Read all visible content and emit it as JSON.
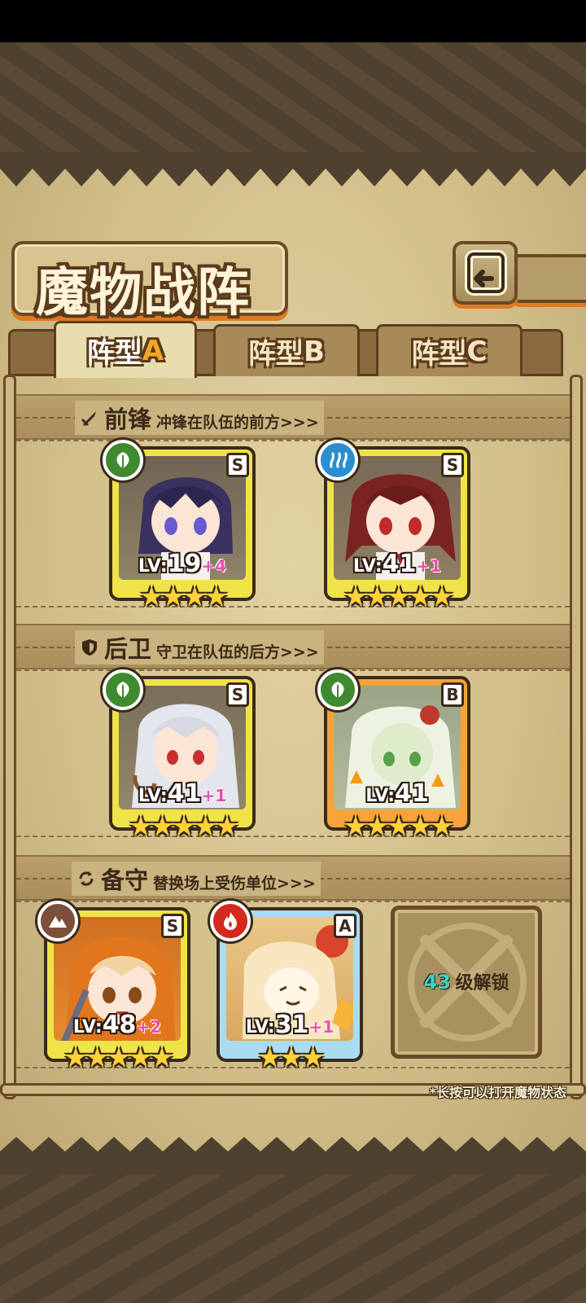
{
  "header": {
    "title": "魔物战阵"
  },
  "tabs": [
    {
      "label": "阵型",
      "suffix": "A",
      "active": true
    },
    {
      "label": "阵型",
      "suffix": "B",
      "active": false
    },
    {
      "label": "阵型",
      "suffix": "C",
      "active": false
    }
  ],
  "sections": {
    "front": {
      "title": "前锋",
      "desc": "冲锋在队伍的前方>>>",
      "icon": "sword-icon"
    },
    "rear": {
      "title": "后卫",
      "desc": "守卫在队伍的后方>>>",
      "icon": "shield-icon"
    },
    "reserve": {
      "title": "备守",
      "desc": "替换场上受伤单位>>>",
      "icon": "swap-icon"
    }
  },
  "cards": {
    "front1": {
      "rank": "S",
      "element": "leaf-element-icon",
      "lv_label": "LV:",
      "level": "19",
      "plus": "+4",
      "stars": "★★★★",
      "frame": "gold"
    },
    "front2": {
      "rank": "S",
      "element": "water-element-icon",
      "lv_label": "LV:",
      "level": "41",
      "plus": "+1",
      "stars": "★★★★★",
      "frame": "gold"
    },
    "rear1": {
      "rank": "S",
      "element": "leaf-element-icon",
      "lv_label": "LV:",
      "level": "41",
      "plus": "+1",
      "stars": "★★★★★",
      "frame": "gold"
    },
    "rear2": {
      "rank": "B",
      "element": "leaf-element-icon",
      "lv_label": "LV:",
      "level": "41",
      "plus": "",
      "stars": "★★★★★",
      "frame": "orange"
    },
    "res1": {
      "rank": "S",
      "element": "earth-element-icon",
      "lv_label": "LV:",
      "level": "48",
      "plus": "+2",
      "stars": "★★★★★",
      "frame": "gold"
    },
    "res2": {
      "rank": "A",
      "element": "fire-element-icon",
      "lv_label": "LV:",
      "level": "31",
      "plus": "+1",
      "stars": "★★★",
      "frame": "blue"
    }
  },
  "locked_slot": {
    "level": "43",
    "text": "级解锁"
  },
  "footer_note": "*长按可以打开魔物状态",
  "colors": {
    "parchment": "#d9c796",
    "border_brown": "#6b4a26",
    "accent_orange": "#e07a1f",
    "leaf_green": "#3f8a2f",
    "water_blue": "#2a8fd0",
    "fire_red": "#d5291e",
    "earth_brown": "#7b4f3a"
  }
}
